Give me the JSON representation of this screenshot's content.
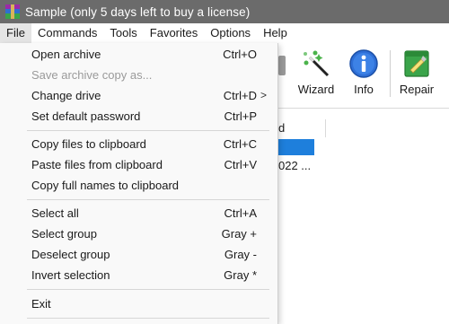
{
  "window": {
    "title": "Sample (only 5 days left to buy a license)"
  },
  "menubar": {
    "items": [
      "File",
      "Commands",
      "Tools",
      "Favorites",
      "Options",
      "Help"
    ]
  },
  "toolbar": {
    "wizard_label": "Wizard",
    "info_label": "Info",
    "repair_label": "Repair"
  },
  "filelist": {
    "header_fragment": "d",
    "row2_fragment": "022 ..."
  },
  "file_menu": {
    "items": [
      {
        "label": "Open archive",
        "shortcut": "Ctrl+O"
      },
      {
        "label": "Save archive copy as...",
        "shortcut": ""
      },
      {
        "label": "Change drive",
        "shortcut": "Ctrl+D"
      },
      {
        "label": "Set default password",
        "shortcut": "Ctrl+P"
      },
      {
        "label": "Copy files to clipboard",
        "shortcut": "Ctrl+C"
      },
      {
        "label": "Paste files from clipboard",
        "shortcut": "Ctrl+V"
      },
      {
        "label": "Copy full names to clipboard",
        "shortcut": ""
      },
      {
        "label": "Select all",
        "shortcut": "Ctrl+A"
      },
      {
        "label": "Select group",
        "shortcut": "Gray +"
      },
      {
        "label": "Deselect group",
        "shortcut": "Gray -"
      },
      {
        "label": "Invert selection",
        "shortcut": "Gray *"
      },
      {
        "label": "Exit",
        "shortcut": ""
      }
    ],
    "submenu_arrow": ">"
  },
  "colors": {
    "titlebar": "#6b6b6b",
    "selection": "#1e7fdc",
    "disabled_text": "#9a9a9a"
  },
  "icons": {
    "app": "winrar-books-icon",
    "wizard": "magic-wand-icon",
    "info": "info-icon",
    "repair": "repair-icon"
  }
}
